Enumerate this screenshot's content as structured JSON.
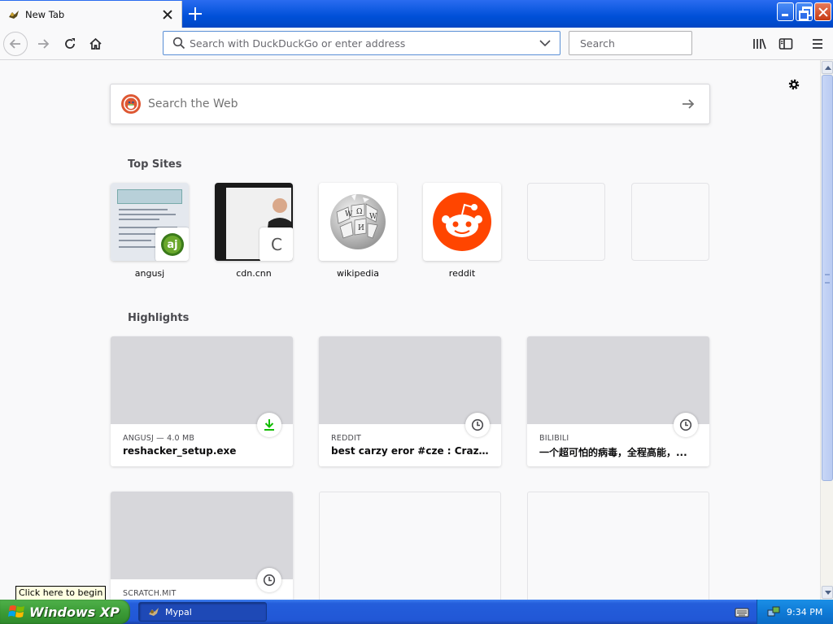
{
  "window": {
    "tab_title": "New Tab",
    "new_tab_symbol": "+"
  },
  "navbar": {
    "url_placeholder": "Search with DuckDuckGo or enter address",
    "search_placeholder": "Search"
  },
  "newtab": {
    "web_search_placeholder": "Search the Web",
    "top_sites_title": "Top Sites",
    "highlights_title": "Highlights",
    "top_sites": [
      {
        "label": "angusj",
        "badge": "aj"
      },
      {
        "label": "cdn.cnn",
        "badge": "C"
      },
      {
        "label": "wikipedia"
      },
      {
        "label": "reddit"
      },
      {
        "label": ""
      },
      {
        "label": ""
      }
    ],
    "highlights": [
      {
        "source": "ANGUSJ — 4.0 MB",
        "title": "reshacker_setup.exe",
        "icon": "download-icon"
      },
      {
        "source": "REDDIT",
        "title": "best carzy eror #cze : CrazyError",
        "icon": "clock-icon"
      },
      {
        "source": "BILIBILI",
        "title": "一个超可怕的病毒，全程高能，...",
        "icon": "clock-icon"
      },
      {
        "source": "SCRATCH.MIT",
        "title": "",
        "icon": "clock-icon"
      }
    ]
  },
  "tooltip": "Click here to begin",
  "taskbar": {
    "start_label": "Windows XP",
    "task_label": "Mypal",
    "clock": "9:34 PM"
  },
  "colors": {
    "reddit": "#ff4500",
    "download_green": "#12bc00",
    "titlebar_blue": "#0050d8"
  }
}
